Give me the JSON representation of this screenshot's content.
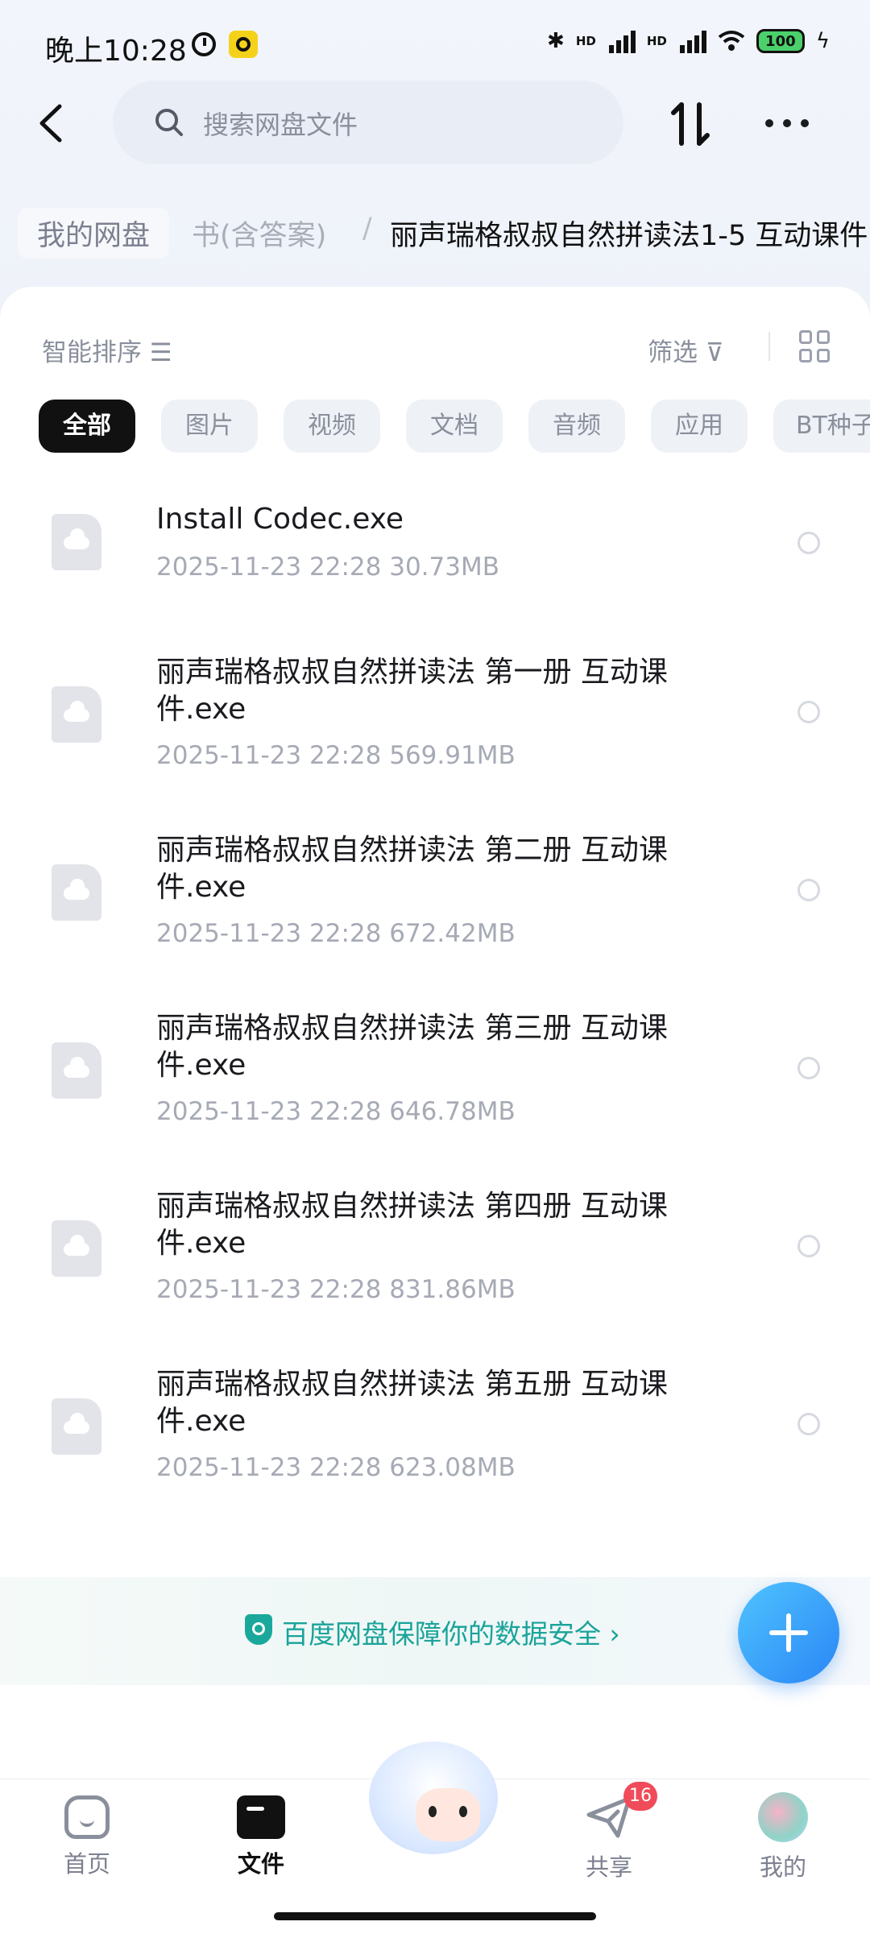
{
  "status_bar": {
    "time": "晚上10:28",
    "battery": "100"
  },
  "header": {
    "search_placeholder": "搜索网盘文件"
  },
  "breadcrumb": {
    "home": "我的网盘",
    "middle": "书(含答案)",
    "separator": "/",
    "current": "丽声瑞格叔叔自然拼读法1-5 互动课件"
  },
  "toolbar": {
    "sort_label": "智能排序 ☰",
    "filter_label": "筛选 ⊽"
  },
  "chips": [
    "全部",
    "图片",
    "视频",
    "文档",
    "音频",
    "应用",
    "BT种子"
  ],
  "files": [
    {
      "name": "Install Codec.exe",
      "date": "2025-11-23",
      "time": "22:28",
      "size": "30.73MB"
    },
    {
      "name": "丽声瑞格叔叔自然拼读法 第一册 互动课件.exe",
      "date": "2025-11-23",
      "time": "22:28",
      "size": "569.91MB"
    },
    {
      "name": "丽声瑞格叔叔自然拼读法 第二册 互动课件.exe",
      "date": "2025-11-23",
      "time": "22:28",
      "size": "672.42MB"
    },
    {
      "name": "丽声瑞格叔叔自然拼读法 第三册 互动课件.exe",
      "date": "2025-11-23",
      "time": "22:28",
      "size": "646.78MB"
    },
    {
      "name": "丽声瑞格叔叔自然拼读法 第四册 互动课件.exe",
      "date": "2025-11-23",
      "time": "22:28",
      "size": "831.86MB"
    },
    {
      "name": "丽声瑞格叔叔自然拼读法 第五册 互动课件.exe",
      "date": "2025-11-23",
      "time": "22:28",
      "size": "623.08MB"
    }
  ],
  "banner": {
    "text": "百度网盘保障你的数据安全 ›"
  },
  "bottom_nav": {
    "items": [
      "首页",
      "文件",
      "共享",
      "我的"
    ],
    "share_badge": "16"
  }
}
